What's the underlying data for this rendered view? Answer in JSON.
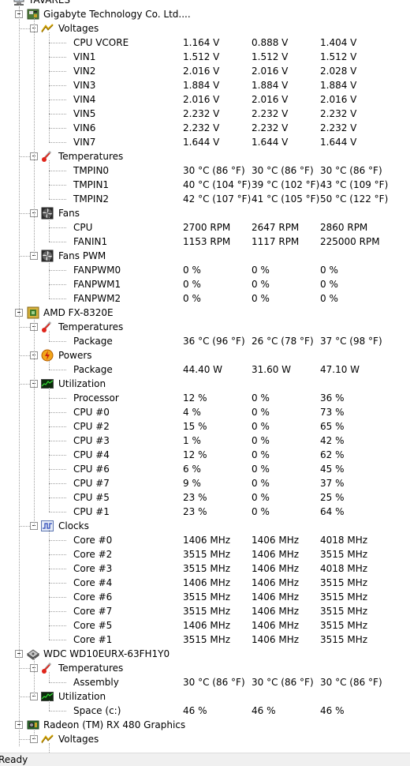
{
  "root": "TAVARES",
  "status": "Ready",
  "tree": [
    {
      "type": "device",
      "name": "Gigabyte Technology Co. Ltd....",
      "icon": "motherboard-icon",
      "groups": [
        {
          "name": "Voltages",
          "icon": "voltage-icon",
          "rows": [
            [
              "CPU VCORE",
              "1.164 V",
              "0.888 V",
              "1.404 V"
            ],
            [
              "VIN1",
              "1.512 V",
              "1.512 V",
              "1.512 V"
            ],
            [
              "VIN2",
              "2.016 V",
              "2.016 V",
              "2.028 V"
            ],
            [
              "VIN3",
              "1.884 V",
              "1.884 V",
              "1.884 V"
            ],
            [
              "VIN4",
              "2.016 V",
              "2.016 V",
              "2.016 V"
            ],
            [
              "VIN5",
              "2.232 V",
              "2.232 V",
              "2.232 V"
            ],
            [
              "VIN6",
              "2.232 V",
              "2.232 V",
              "2.232 V"
            ],
            [
              "VIN7",
              "1.644 V",
              "1.644 V",
              "1.644 V"
            ]
          ]
        },
        {
          "name": "Temperatures",
          "icon": "thermometer-icon",
          "rows": [
            [
              "TMPIN0",
              "30 °C  (86 °F)",
              "30 °C  (86 °F)",
              "30 °C  (86 °F)"
            ],
            [
              "TMPIN1",
              "40 °C  (104 °F)",
              "39 °C  (102 °F)",
              "43 °C  (109 °F)"
            ],
            [
              "TMPIN2",
              "42 °C  (107 °F)",
              "41 °C  (105 °F)",
              "50 °C  (122 °F)"
            ]
          ]
        },
        {
          "name": "Fans",
          "icon": "fan-icon",
          "rows": [
            [
              "CPU",
              "2700 RPM",
              "2647 RPM",
              "2860 RPM"
            ],
            [
              "FANIN1",
              "1153 RPM",
              "1117 RPM",
              "225000 RPM"
            ]
          ]
        },
        {
          "name": "Fans PWM",
          "icon": "fan-pwm-icon",
          "rows": [
            [
              "FANPWM0",
              "0 %",
              "0 %",
              "0 %"
            ],
            [
              "FANPWM1",
              "0 %",
              "0 %",
              "0 %"
            ],
            [
              "FANPWM2",
              "0 %",
              "0 %",
              "0 %"
            ]
          ]
        }
      ]
    },
    {
      "type": "device",
      "name": "AMD FX-8320E",
      "icon": "cpu-icon",
      "groups": [
        {
          "name": "Temperatures",
          "icon": "thermometer-icon",
          "rows": [
            [
              "Package",
              "36 °C  (96 °F)",
              "26 °C  (78 °F)",
              "37 °C  (98 °F)"
            ]
          ]
        },
        {
          "name": "Powers",
          "icon": "power-icon",
          "rows": [
            [
              "Package",
              "44.40 W",
              "31.60 W",
              "47.10 W"
            ]
          ]
        },
        {
          "name": "Utilization",
          "icon": "utilization-icon",
          "rows": [
            [
              "Processor",
              "12 %",
              "0 %",
              "36 %"
            ],
            [
              "CPU #0",
              "4 %",
              "0 %",
              "73 %"
            ],
            [
              "CPU #2",
              "15 %",
              "0 %",
              "65 %"
            ],
            [
              "CPU #3",
              "1 %",
              "0 %",
              "42 %"
            ],
            [
              "CPU #4",
              "12 %",
              "0 %",
              "62 %"
            ],
            [
              "CPU #6",
              "6 %",
              "0 %",
              "45 %"
            ],
            [
              "CPU #7",
              "9 %",
              "0 %",
              "37 %"
            ],
            [
              "CPU #5",
              "23 %",
              "0 %",
              "25 %"
            ],
            [
              "CPU #1",
              "23 %",
              "0 %",
              "64 %"
            ]
          ]
        },
        {
          "name": "Clocks",
          "icon": "clock-icon",
          "rows": [
            [
              "Core #0",
              "1406 MHz",
              "1406 MHz",
              "4018 MHz"
            ],
            [
              "Core #2",
              "3515 MHz",
              "1406 MHz",
              "3515 MHz"
            ],
            [
              "Core #3",
              "3515 MHz",
              "1406 MHz",
              "4018 MHz"
            ],
            [
              "Core #4",
              "1406 MHz",
              "1406 MHz",
              "3515 MHz"
            ],
            [
              "Core #6",
              "3515 MHz",
              "1406 MHz",
              "3515 MHz"
            ],
            [
              "Core #7",
              "3515 MHz",
              "1406 MHz",
              "3515 MHz"
            ],
            [
              "Core #5",
              "1406 MHz",
              "1406 MHz",
              "3515 MHz"
            ],
            [
              "Core #1",
              "3515 MHz",
              "1406 MHz",
              "3515 MHz"
            ]
          ]
        }
      ]
    },
    {
      "type": "device",
      "name": "WDC WD10EURX-63FH1Y0",
      "icon": "hdd-icon",
      "groups": [
        {
          "name": "Temperatures",
          "icon": "thermometer-icon",
          "rows": [
            [
              "Assembly",
              "30 °C  (86 °F)",
              "30 °C  (86 °F)",
              "30 °C  (86 °F)"
            ]
          ]
        },
        {
          "name": "Utilization",
          "icon": "utilization-icon",
          "rows": [
            [
              "Space (c:)",
              "46 %",
              "46 %",
              "46 %"
            ]
          ]
        }
      ]
    },
    {
      "type": "device",
      "name": "Radeon (TM) RX 480 Graphics",
      "icon": "gpu-icon",
      "groups": [
        {
          "name": "Voltages",
          "icon": "voltage-icon",
          "rows": []
        }
      ]
    }
  ]
}
